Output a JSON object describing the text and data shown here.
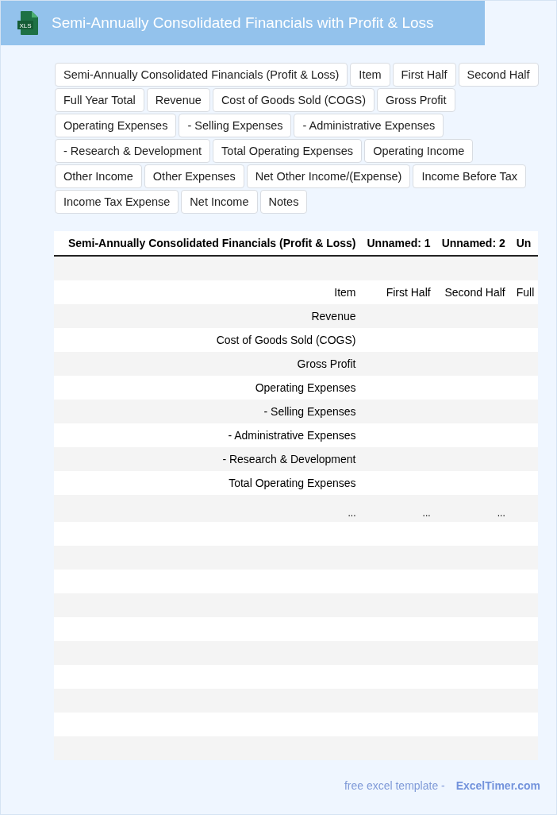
{
  "header": {
    "icon_label": "XLS",
    "title": "Semi-Annually Consolidated Financials with Profit & Loss"
  },
  "chips": [
    "Semi-Annually Consolidated Financials (Profit & Loss)",
    "Item",
    "First Half",
    "Second Half",
    "Full Year Total",
    "Revenue",
    "Cost of Goods Sold (COGS)",
    "Gross Profit",
    "Operating Expenses",
    "- Selling Expenses",
    "- Administrative Expenses",
    "- Research & Development",
    "Total Operating Expenses",
    "Operating Income",
    "Other Income",
    "Other Expenses",
    "Net Other Income/(Expense)",
    "Income Before Tax",
    "Income Tax Expense",
    "Net Income",
    "Notes"
  ],
  "table": {
    "columns": [
      "Semi-Annually Consolidated Financials (Profit & Loss)",
      "Unnamed: 1",
      "Unnamed: 2",
      "Un"
    ],
    "rows": [
      {},
      {
        "column_1": "Item",
        "column_2": "First Half",
        "column_3": "Second Half",
        "column_4": "Full"
      },
      {
        "column_1": "Revenue"
      },
      {
        "column_1": "Cost of Goods Sold (COGS)"
      },
      {
        "column_1": "Gross Profit"
      },
      {
        "column_1": "Operating Expenses"
      },
      {
        "column_1": "- Selling Expenses"
      },
      {
        "column_1": "- Administrative Expenses"
      },
      {
        "column_1": "- Research & Development"
      },
      {
        "column_1": "Total Operating Expenses"
      },
      {
        "kind": "ellipsis",
        "column_1": "...",
        "column_2": "...",
        "column_3": "..."
      },
      {},
      {},
      {},
      {},
      {},
      {},
      {},
      {},
      {},
      {}
    ]
  },
  "footer": {
    "text": "free excel template -",
    "link": "ExcelTimer.com"
  }
}
